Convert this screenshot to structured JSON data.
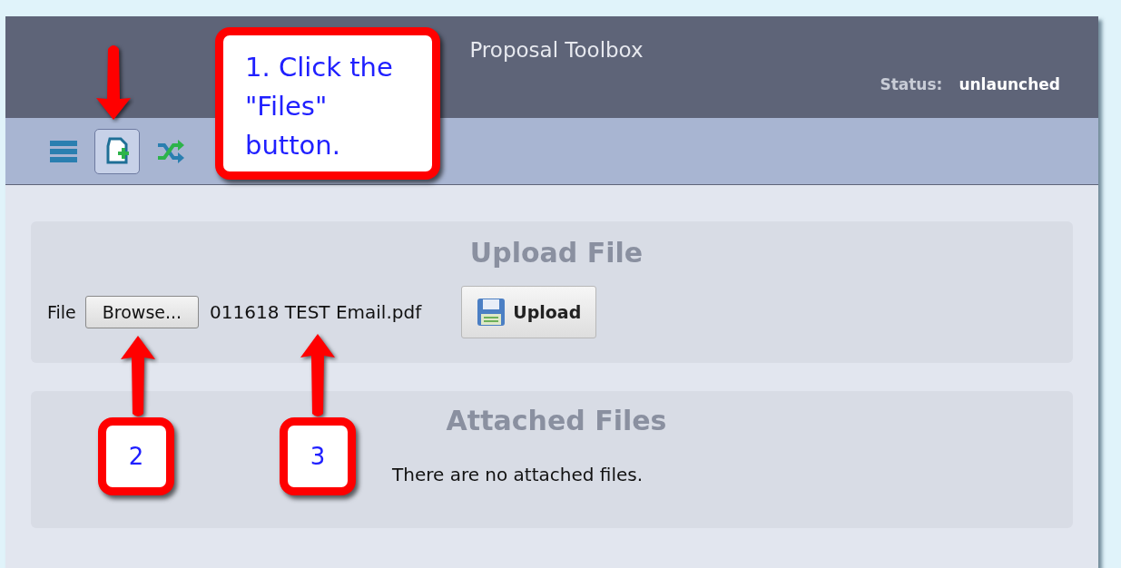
{
  "window": {
    "title": "Proposal Toolbox",
    "status_label": "Status:",
    "status_value": "unlaunched"
  },
  "toolbar": [
    {
      "kind": "menu",
      "selected": false
    },
    {
      "kind": "file-add",
      "selected": true
    },
    {
      "kind": "shuffle",
      "selected": false
    }
  ],
  "upload_panel": {
    "title": "Upload File",
    "field_label": "File",
    "browse_button": "Browse...",
    "file_name": "011618 TEST Email.pdf",
    "upload_button": "Upload"
  },
  "attached_panel": {
    "title": "Attached Files",
    "empty_message": "There are no attached files."
  },
  "annotations": [
    {
      "kind": "note",
      "text": "1. Click the \"Files\" button."
    },
    {
      "kind": "number",
      "text": "2"
    },
    {
      "kind": "number",
      "text": "3"
    }
  ]
}
